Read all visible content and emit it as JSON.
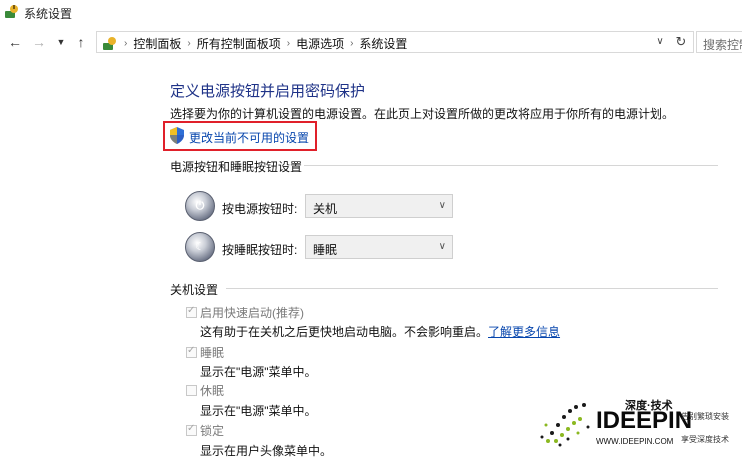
{
  "window": {
    "title": "系统设置"
  },
  "nav": {
    "back_icon": "arrow-left-icon",
    "forward_icon": "arrow-right-icon",
    "recent_icon": "chevron-down-icon",
    "up_icon": "arrow-up-icon",
    "breadcrumbs": [
      "控制面板",
      "所有控制面板项",
      "电源选项",
      "系统设置"
    ],
    "refresh_icon": "refresh-icon",
    "search_placeholder": "搜索控制"
  },
  "main": {
    "heading": "定义电源按钮并启用密码保护",
    "description": "选择要为你的计算机设置的电源设置。在此页上对设置所做的更改将应用于你所有的电源计划。",
    "change_link": "更改当前不可用的设置",
    "highlight_color": "#e0202a"
  },
  "power_section": {
    "title": "电源按钮和睡眠按钮设置",
    "power_button_label": "按电源按钮时:",
    "power_button_value": "关机",
    "sleep_button_label": "按睡眠按钮时:",
    "sleep_button_value": "睡眠"
  },
  "shutdown_section": {
    "title": "关机设置",
    "items": [
      {
        "label": "启用快速启动(推荐)",
        "checked": true,
        "desc": "这有助于在关机之后更快地启动电脑。不会影响重启。",
        "link": "了解更多信息"
      },
      {
        "label": "睡眠",
        "checked": true,
        "desc": "显示在\"电源\"菜单中。"
      },
      {
        "label": "休眠",
        "checked": false,
        "desc": "显示在\"电源\"菜单中。"
      },
      {
        "label": "锁定",
        "checked": true,
        "desc": "显示在用户头像菜单中。"
      }
    ]
  },
  "watermark": {
    "brand": "深度·技术",
    "logo": "IDEEPIN",
    "url": "WWW.IDEEPIN.COM",
    "tagline1": "告别繁琐安装",
    "tagline2": "享受深度技术"
  }
}
